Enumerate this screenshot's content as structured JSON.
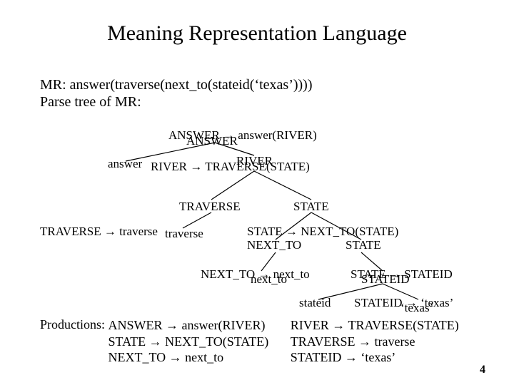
{
  "title": "Meaning Representation Language",
  "mr_line": "MR: answer(traverse(next_to(stateid(‘texas’))))",
  "parse_line": "Parse tree of MR:",
  "tree": {
    "n_answer_rule_top": "ANSWER → answer(RIVER)",
    "n_answer_label": "ANSWER",
    "n_answer_leaf": "answer",
    "n_river_rule": "RIVER → TRAVERSE(STATE)",
    "n_river_label": "RIVER",
    "n_traverse_label": "TRAVERSE",
    "n_state_label": "STATE",
    "n_traverse_rule": "TRAVERSE → traverse",
    "n_traverse_leaf": "traverse",
    "n_state_rule": "STATE → NEXT_TO(STATE)",
    "n_nextto_label": "NEXT_TO",
    "n_state_label2": "STATE",
    "n_nextto_rule": "NEXT_TO → next_to",
    "n_nextto_leaf": "next_to",
    "n_state_rule2": "STATE → STATEID",
    "n_stateid_label": "STATEID",
    "n_stateid_leaf": "stateid",
    "n_stateid_rule": "STATEID → ‘texas’",
    "n_texas_leaf": "‘texas’"
  },
  "productions": {
    "lead": "Productions:",
    "left": [
      "ANSWER → answer(RIVER)",
      "STATE → NEXT_TO(STATE)",
      "NEXT_TO → next_to"
    ],
    "right": [
      "RIVER → TRAVERSE(STATE)",
      "TRAVERSE → traverse",
      "STATEID → ‘texas’"
    ]
  },
  "page_num": "4"
}
